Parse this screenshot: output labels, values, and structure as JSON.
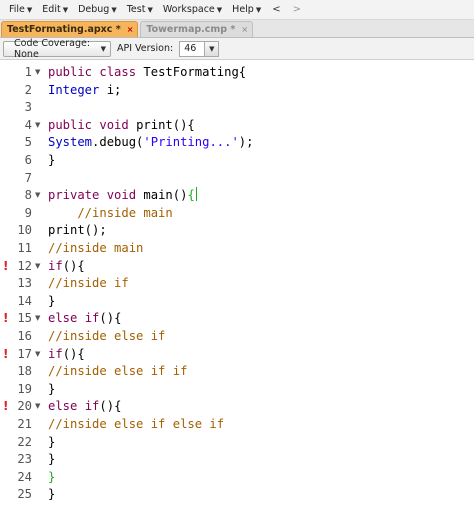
{
  "menu": {
    "items": [
      {
        "label": "File"
      },
      {
        "label": "Edit"
      },
      {
        "label": "Debug"
      },
      {
        "label": "Test"
      },
      {
        "label": "Workspace"
      },
      {
        "label": "Help"
      }
    ],
    "back": "<",
    "forward": ">"
  },
  "tabs": [
    {
      "label": "TestFormating.apxc *",
      "close": "×"
    },
    {
      "label": "Towermap.cmp *",
      "close": "×"
    }
  ],
  "toolbar": {
    "coverage_label": "Code Coverage: None",
    "api_label": "API Version:",
    "api_value": "46"
  },
  "editor": {
    "lines": [
      {
        "num": "1",
        "warn": "",
        "fold": "▼",
        "tokens": [
          [
            "kw",
            "public"
          ],
          [
            "",
            " "
          ],
          [
            "kw",
            "class"
          ],
          [
            "",
            " TestFormating{"
          ]
        ]
      },
      {
        "num": "2",
        "warn": "",
        "fold": "",
        "tokens": [
          [
            "ty",
            "Integer"
          ],
          [
            "",
            " i;"
          ]
        ]
      },
      {
        "num": "3",
        "warn": "",
        "fold": "",
        "tokens": []
      },
      {
        "num": "4",
        "warn": "",
        "fold": "▼",
        "tokens": [
          [
            "kw",
            "public"
          ],
          [
            "",
            " "
          ],
          [
            "kw",
            "void"
          ],
          [
            "",
            " print(){"
          ]
        ]
      },
      {
        "num": "5",
        "warn": "",
        "fold": "",
        "tokens": [
          [
            "ty",
            "System"
          ],
          [
            "",
            ".debug("
          ],
          [
            "str",
            "'Printing...'"
          ],
          [
            "",
            ");"
          ]
        ]
      },
      {
        "num": "6",
        "warn": "",
        "fold": "",
        "tokens": [
          [
            "",
            "}"
          ]
        ]
      },
      {
        "num": "7",
        "warn": "",
        "fold": "",
        "tokens": []
      },
      {
        "num": "8",
        "warn": "",
        "fold": "▼",
        "tokens": [
          [
            "kw",
            "private"
          ],
          [
            "",
            " "
          ],
          [
            "kw",
            "void"
          ],
          [
            "",
            " main()"
          ],
          [
            "brace-hl",
            "{"
          ]
        ]
      },
      {
        "num": "9",
        "warn": "",
        "fold": "",
        "tokens": [
          [
            "cmt",
            "    //inside main"
          ]
        ]
      },
      {
        "num": "10",
        "warn": "",
        "fold": "",
        "tokens": [
          [
            "",
            "print();"
          ]
        ]
      },
      {
        "num": "11",
        "warn": "",
        "fold": "",
        "tokens": [
          [
            "cmt",
            "//inside main"
          ]
        ]
      },
      {
        "num": "12",
        "warn": "!",
        "fold": "▼",
        "tokens": [
          [
            "kw",
            "if"
          ],
          [
            "",
            "(){"
          ]
        ]
      },
      {
        "num": "13",
        "warn": "",
        "fold": "",
        "tokens": [
          [
            "cmt",
            "//inside if"
          ]
        ]
      },
      {
        "num": "14",
        "warn": "",
        "fold": "",
        "tokens": [
          [
            "",
            "}"
          ]
        ]
      },
      {
        "num": "15",
        "warn": "!",
        "fold": "▼",
        "tokens": [
          [
            "kw",
            "else"
          ],
          [
            "",
            " "
          ],
          [
            "kw",
            "if"
          ],
          [
            "",
            "(){"
          ]
        ]
      },
      {
        "num": "16",
        "warn": "",
        "fold": "",
        "tokens": [
          [
            "cmt",
            "//inside else if"
          ]
        ]
      },
      {
        "num": "17",
        "warn": "!",
        "fold": "▼",
        "tokens": [
          [
            "kw",
            "if"
          ],
          [
            "",
            "(){"
          ]
        ]
      },
      {
        "num": "18",
        "warn": "",
        "fold": "",
        "tokens": [
          [
            "cmt",
            "//inside else if if"
          ]
        ]
      },
      {
        "num": "19",
        "warn": "",
        "fold": "",
        "tokens": [
          [
            "",
            "}"
          ]
        ]
      },
      {
        "num": "20",
        "warn": "!",
        "fold": "▼",
        "tokens": [
          [
            "kw",
            "else"
          ],
          [
            "",
            " "
          ],
          [
            "kw",
            "if"
          ],
          [
            "",
            "(){"
          ]
        ]
      },
      {
        "num": "21",
        "warn": "",
        "fold": "",
        "tokens": [
          [
            "cmt",
            "//inside else if else if"
          ]
        ]
      },
      {
        "num": "22",
        "warn": "",
        "fold": "",
        "tokens": [
          [
            "",
            "}"
          ]
        ]
      },
      {
        "num": "23",
        "warn": "",
        "fold": "",
        "tokens": [
          [
            "",
            "}"
          ]
        ]
      },
      {
        "num": "24",
        "warn": "",
        "fold": "",
        "tokens": [
          [
            "brace-hl",
            "}"
          ]
        ]
      },
      {
        "num": "25",
        "warn": "",
        "fold": "",
        "tokens": [
          [
            "",
            "}"
          ]
        ]
      }
    ]
  },
  "colors": {
    "active_tab": "#f7b55b",
    "keyword": "#7f0055",
    "type": "#0000c0",
    "string": "#2a00ff",
    "comment": "#a35f00",
    "brace_match": "#22aa22",
    "warning": "#dd2222"
  }
}
